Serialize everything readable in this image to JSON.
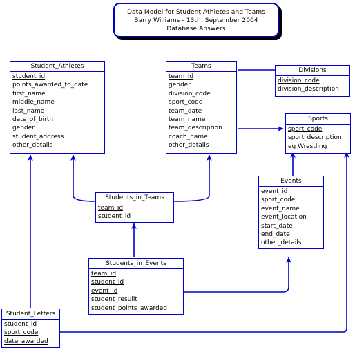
{
  "diagram": {
    "title_lines": [
      "Data Model for Student Athletes and Teams",
      "Barry Williams - 13th. September 2004",
      "Database Answers"
    ],
    "accent_color": "#0000cc",
    "background_color": "#ffffff",
    "shadow_color": "#000000"
  },
  "entities": [
    {
      "id": "student_athletes",
      "name": "Student_Athletes",
      "attributes": [
        {
          "name": "student_id",
          "pk": true
        },
        {
          "name": "points_awarded_to_date",
          "pk": false
        },
        {
          "name": "first_name",
          "pk": false
        },
        {
          "name": "middle_name",
          "pk": false
        },
        {
          "name": "last_name",
          "pk": false
        },
        {
          "name": "date_of_birth",
          "pk": false
        },
        {
          "name": "gender",
          "pk": false
        },
        {
          "name": "student_address",
          "pk": false
        },
        {
          "name": "other_details",
          "pk": false
        }
      ]
    },
    {
      "id": "teams",
      "name": "Teams",
      "attributes": [
        {
          "name": "team_id",
          "pk": true
        },
        {
          "name": "gender",
          "pk": false
        },
        {
          "name": "division_code",
          "pk": false
        },
        {
          "name": "sport_code",
          "pk": false
        },
        {
          "name": "team_date",
          "pk": false
        },
        {
          "name": "team_name",
          "pk": false
        },
        {
          "name": "team_description",
          "pk": false
        },
        {
          "name": "coach_name",
          "pk": false
        },
        {
          "name": "other_details",
          "pk": false
        }
      ]
    },
    {
      "id": "divisions",
      "name": "Divisions",
      "attributes": [
        {
          "name": "division_code",
          "pk": true
        },
        {
          "name": "division_description",
          "pk": false
        }
      ]
    },
    {
      "id": "sports",
      "name": "Sports",
      "attributes": [
        {
          "name": "sport_code",
          "pk": true
        },
        {
          "name": "sport_description",
          "pk": false
        },
        {
          "name": "eg Wrestling",
          "pk": false
        }
      ]
    },
    {
      "id": "events",
      "name": "Events",
      "attributes": [
        {
          "name": "event_id",
          "pk": true
        },
        {
          "name": "sport_code",
          "pk": false
        },
        {
          "name": "event_name",
          "pk": false
        },
        {
          "name": "event_location",
          "pk": false
        },
        {
          "name": "start_date",
          "pk": false
        },
        {
          "name": "end_date",
          "pk": false
        },
        {
          "name": "other_details",
          "pk": false
        }
      ]
    },
    {
      "id": "students_in_teams",
      "name": "Students_in_Teams",
      "attributes": [
        {
          "name": "team_id",
          "pk": true
        },
        {
          "name": "student_id",
          "pk": true
        }
      ]
    },
    {
      "id": "students_in_events",
      "name": "Students_in_Events",
      "attributes": [
        {
          "name": "team_id",
          "pk": true
        },
        {
          "name": "student_id",
          "pk": true
        },
        {
          "name": "event_id",
          "pk": true
        },
        {
          "name": "student_resullt",
          "pk": false
        },
        {
          "name": "student_points_awarded",
          "pk": false
        }
      ]
    },
    {
      "id": "student_letters",
      "name": "Student_Letters",
      "attributes": [
        {
          "name": "student_id",
          "pk": true
        },
        {
          "name": "sport_code",
          "pk": true
        },
        {
          "name": "date_awarded",
          "pk": true
        }
      ]
    }
  ],
  "relationships": [
    {
      "from": "teams",
      "to": "divisions"
    },
    {
      "from": "teams",
      "to": "sports"
    },
    {
      "from": "events",
      "to": "sports"
    },
    {
      "from": "student_letters",
      "to": "sports"
    },
    {
      "from": "student_letters",
      "to": "student_athletes"
    },
    {
      "from": "students_in_teams",
      "to": "student_athletes"
    },
    {
      "from": "students_in_teams",
      "to": "teams"
    },
    {
      "from": "students_in_events",
      "to": "students_in_teams"
    },
    {
      "from": "students_in_events",
      "to": "events"
    }
  ]
}
